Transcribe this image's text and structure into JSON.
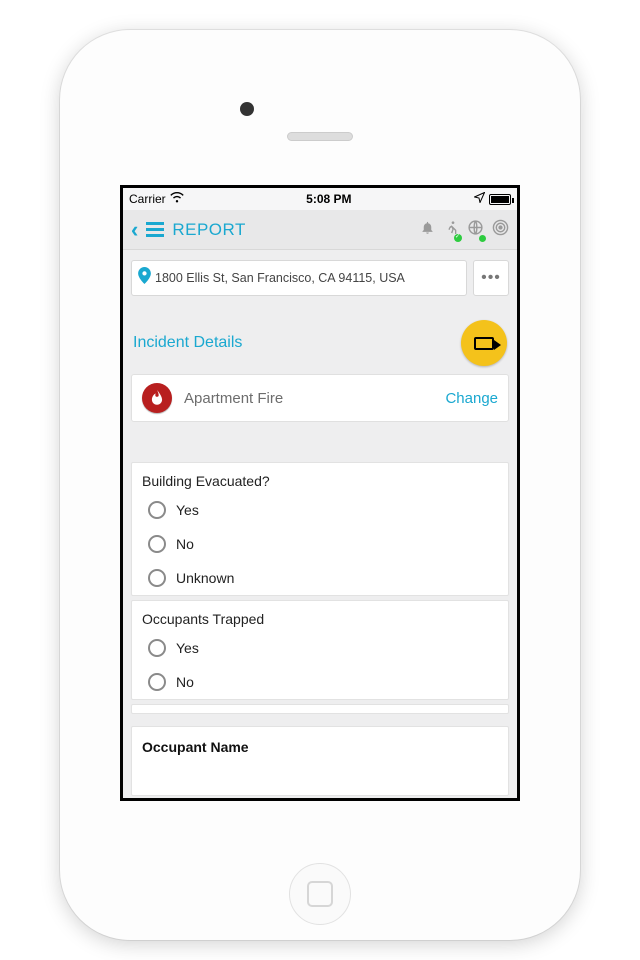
{
  "status_bar": {
    "carrier": "Carrier",
    "time": "5:08 PM"
  },
  "nav": {
    "title": "REPORT"
  },
  "address": "1800 Ellis St, San Francisco, CA 94115, USA",
  "section_title": "Incident Details",
  "incident": {
    "type_label": "Apartment Fire",
    "change_label": "Change"
  },
  "questions": [
    {
      "label": "Building Evacuated?",
      "options": [
        "Yes",
        "No",
        "Unknown"
      ]
    },
    {
      "label": "Occupants Trapped",
      "options": [
        "Yes",
        "No"
      ]
    }
  ],
  "occupant_name_label": "Occupant Name",
  "colors": {
    "accent": "#1aa8d0",
    "video_btn": "#f4c21b",
    "fire_badge": "#b81f1f"
  }
}
